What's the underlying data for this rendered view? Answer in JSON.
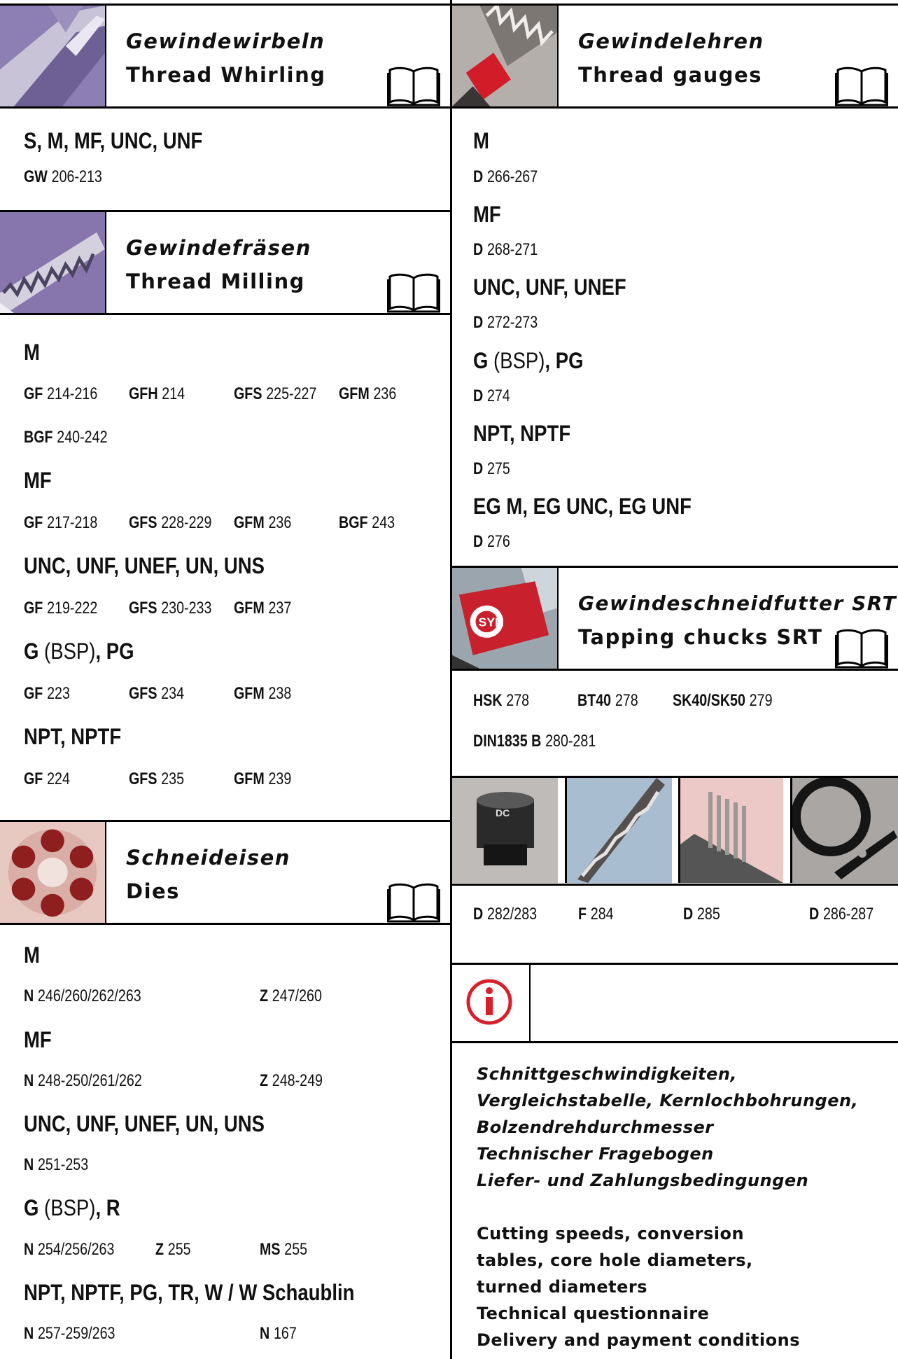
{
  "left": {
    "whirling": {
      "title_de": "Gewindewirbeln",
      "title_en": "Thread Whirling",
      "heading": "S, M, MF, UNC, UNF",
      "refs": [
        {
          "code": "GW",
          "pages": "206-213"
        }
      ]
    },
    "milling": {
      "title_de": "Gewindefräsen",
      "title_en": "Thread Milling",
      "groups": [
        {
          "heading": "M",
          "refs": [
            {
              "code": "GF",
              "pages": "214-216"
            },
            {
              "code": "GFH",
              "pages": "214"
            },
            {
              "code": "GFS",
              "pages": "225-227"
            },
            {
              "code": "GFM",
              "pages": "236"
            },
            {
              "code": "BGF",
              "pages": "240-242"
            }
          ]
        },
        {
          "heading": "MF",
          "refs": [
            {
              "code": "GF",
              "pages": "217-218"
            },
            {
              "code": "GFS",
              "pages": "228-229"
            },
            {
              "code": "GFM",
              "pages": "236"
            },
            {
              "code": "BGF",
              "pages": "243"
            }
          ]
        },
        {
          "heading": "UNC, UNF, UNEF, UN, UNS",
          "refs": [
            {
              "code": "GF",
              "pages": "219-222"
            },
            {
              "code": "GFS",
              "pages": "230-233"
            },
            {
              "code": "GFM",
              "pages": "237"
            }
          ]
        },
        {
          "heading_a": "G",
          "heading_b": " (BSP)",
          "heading_c": ", PG",
          "refs": [
            {
              "code": "GF",
              "pages": "223"
            },
            {
              "code": "GFS",
              "pages": "234"
            },
            {
              "code": "GFM",
              "pages": "238"
            }
          ]
        },
        {
          "heading": "NPT, NPTF",
          "refs": [
            {
              "code": "GF",
              "pages": "224"
            },
            {
              "code": "GFS",
              "pages": "235"
            },
            {
              "code": "GFM",
              "pages": "239"
            }
          ]
        }
      ]
    },
    "dies": {
      "title_de": "Schneideisen",
      "title_en": "Dies",
      "groups": [
        {
          "heading": "M",
          "refs": [
            {
              "code": "N",
              "pages": "246/260/262/263"
            },
            {
              "code": "Z",
              "pages": "247/260"
            }
          ]
        },
        {
          "heading": "MF",
          "refs": [
            {
              "code": "N",
              "pages": "248-250/261/262"
            },
            {
              "code": "Z",
              "pages": "248-249"
            }
          ]
        },
        {
          "heading": "UNC, UNF, UNEF, UN, UNS",
          "refs": [
            {
              "code": "N",
              "pages": "251-253"
            }
          ]
        },
        {
          "heading_a": "G",
          "heading_b": " (BSP)",
          "heading_c": ", R",
          "refs": [
            {
              "code": "N",
              "pages": "254/256/263"
            },
            {
              "code": "Z",
              "pages": "255"
            },
            {
              "code": "MS",
              "pages": "255"
            }
          ]
        },
        {
          "heading": "NPT, NPTF, PG, TR, W / W Schaublin",
          "refs": [
            {
              "code": "N",
              "pages": "257-259/263"
            },
            {
              "code": "N",
              "pages": "167"
            }
          ]
        }
      ]
    }
  },
  "right": {
    "gauges": {
      "title_de": "Gewindelehren",
      "title_en": "Thread gauges",
      "groups": [
        {
          "heading": "M",
          "refs": [
            {
              "code": "D",
              "pages": "266-267"
            }
          ]
        },
        {
          "heading": "MF",
          "refs": [
            {
              "code": "D",
              "pages": "268-271"
            }
          ]
        },
        {
          "heading": "UNC, UNF, UNEF",
          "refs": [
            {
              "code": "D",
              "pages": "272-273"
            }
          ]
        },
        {
          "heading_a": "G",
          "heading_b": " (BSP)",
          "heading_c": ", PG",
          "refs": [
            {
              "code": "D",
              "pages": "274"
            }
          ]
        },
        {
          "heading": "NPT, NPTF",
          "refs": [
            {
              "code": "D",
              "pages": "275"
            }
          ]
        },
        {
          "heading": "EG M, EG UNC, EG UNF",
          "refs": [
            {
              "code": "D",
              "pages": "276"
            }
          ]
        }
      ]
    },
    "chucks": {
      "title_de": "Gewindeschneidfutter SRT",
      "title_en": "Tapping chucks SRT",
      "thumb_text": "SYN",
      "refs": [
        {
          "code": "HSK",
          "pages": "278"
        },
        {
          "code": "BT40",
          "pages": "278"
        },
        {
          "code": "SK40/SK50",
          "pages": "279"
        },
        {
          "code": "DIN1835 B",
          "pages": "280-281"
        }
      ]
    },
    "accessories": {
      "thumb_label": "DC",
      "refs": [
        {
          "code": "D",
          "pages": "282/283"
        },
        {
          "code": "F",
          "pages": "284"
        },
        {
          "code": "D",
          "pages": "285"
        },
        {
          "code": "D",
          "pages": "286-287"
        }
      ]
    },
    "info": {
      "de_lines": [
        "Schnittgeschwindigkeiten,",
        "Vergleichstabelle, Kernlochbohrungen,",
        "Bolzendrehdurchmesser",
        "Technischer Fragebogen",
        "Liefer- und Zahlungsbedingungen"
      ],
      "en_lines": [
        "Cutting speeds, conversion",
        "tables, core hole diameters,",
        "turned diameters",
        "Technical questionnaire",
        "Delivery and payment conditions"
      ]
    }
  },
  "colors": {
    "purple": "#7b6aa8",
    "red": "#d8202a",
    "gray": "#a9a6a4"
  }
}
